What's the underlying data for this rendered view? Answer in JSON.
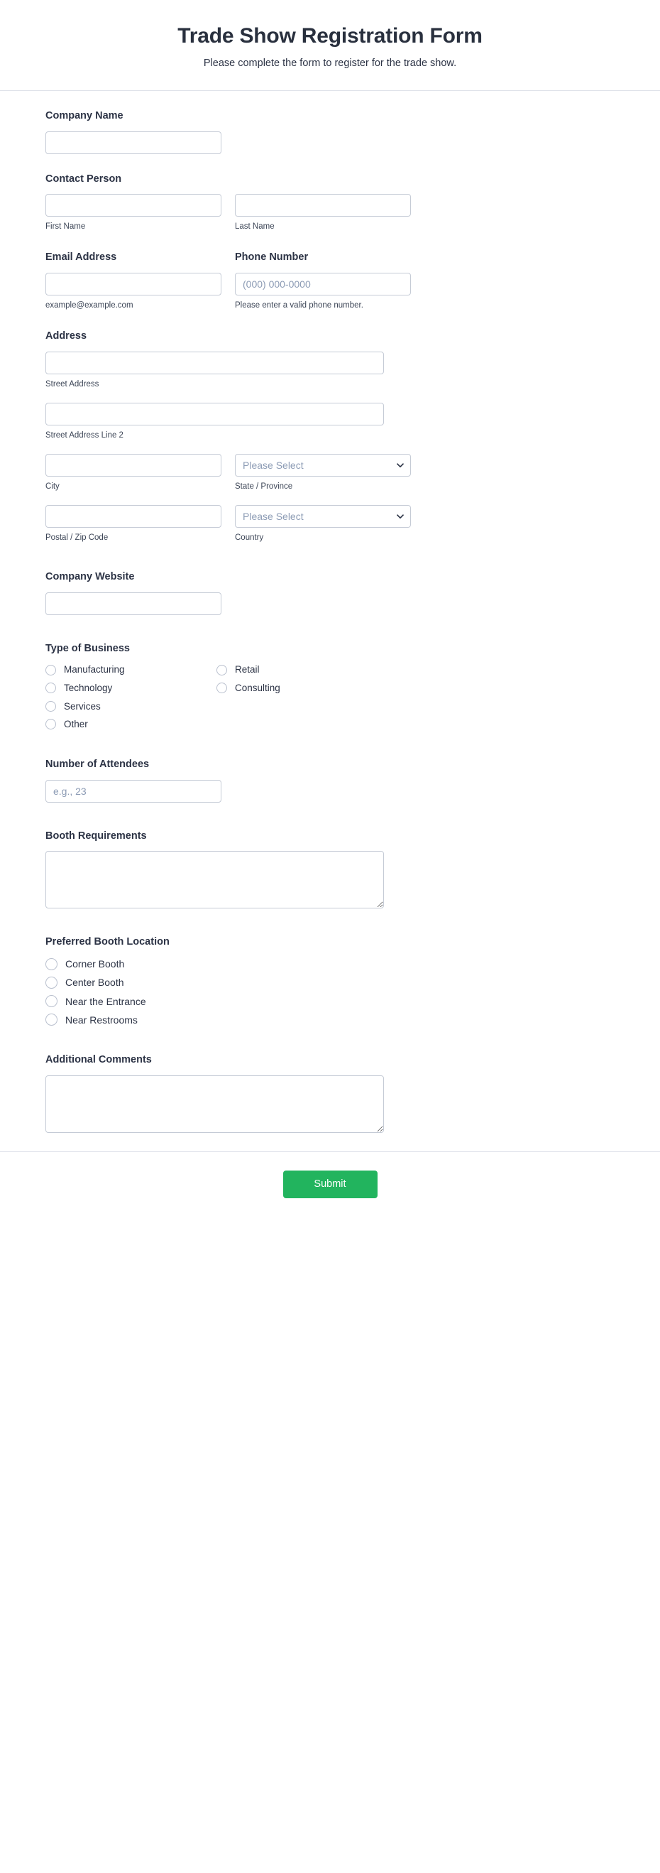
{
  "header": {
    "title": "Trade Show Registration Form",
    "subtitle": "Please complete the form to register for the trade show."
  },
  "colors": {
    "submit_green": "#22b45e",
    "label_text": "#2c3345",
    "input_border": "#c5cbd6",
    "placeholder": "#8d9cb5",
    "divider": "#dfe2ea"
  },
  "fields": {
    "company_name": {
      "label": "Company Name",
      "value": "",
      "placeholder": ""
    },
    "contact_person": {
      "label": "Contact Person",
      "first_name": {
        "sub_label": "First Name",
        "value": "",
        "placeholder": ""
      },
      "last_name": {
        "sub_label": "Last Name",
        "value": "",
        "placeholder": ""
      }
    },
    "email": {
      "label": "Email Address",
      "value": "",
      "placeholder": "",
      "help": "example@example.com"
    },
    "phone": {
      "label": "Phone Number",
      "value": "",
      "placeholder": "(000) 000-0000",
      "help": "Please enter a valid phone number."
    },
    "address": {
      "label": "Address",
      "street": {
        "sub_label": "Street Address",
        "value": "",
        "placeholder": ""
      },
      "street2": {
        "sub_label": "Street Address Line 2",
        "value": "",
        "placeholder": ""
      },
      "city": {
        "sub_label": "City",
        "value": "",
        "placeholder": ""
      },
      "state": {
        "sub_label": "State / Province",
        "selected": "Please Select",
        "icon": "chevron-down-icon"
      },
      "postal": {
        "sub_label": "Postal / Zip Code",
        "value": "",
        "placeholder": ""
      },
      "country": {
        "sub_label": "Country",
        "selected": "Please Select",
        "icon": "chevron-down-icon"
      }
    },
    "website": {
      "label": "Company Website",
      "value": "",
      "placeholder": ""
    },
    "business_type": {
      "label": "Type of Business",
      "options_col1": [
        "Manufacturing",
        "Technology",
        "Services",
        "Other"
      ],
      "options_col2": [
        "Retail",
        "Consulting"
      ]
    },
    "attendees": {
      "label": "Number of Attendees",
      "value": "",
      "placeholder": "e.g., 23"
    },
    "booth_requirements": {
      "label": "Booth Requirements",
      "value": "",
      "placeholder": ""
    },
    "booth_location": {
      "label": "Preferred Booth Location",
      "options": [
        "Corner Booth",
        "Center Booth",
        "Near the Entrance",
        "Near Restrooms"
      ]
    },
    "additional_comments": {
      "label": "Additional Comments",
      "value": "",
      "placeholder": ""
    }
  },
  "footer": {
    "submit_label": "Submit"
  }
}
